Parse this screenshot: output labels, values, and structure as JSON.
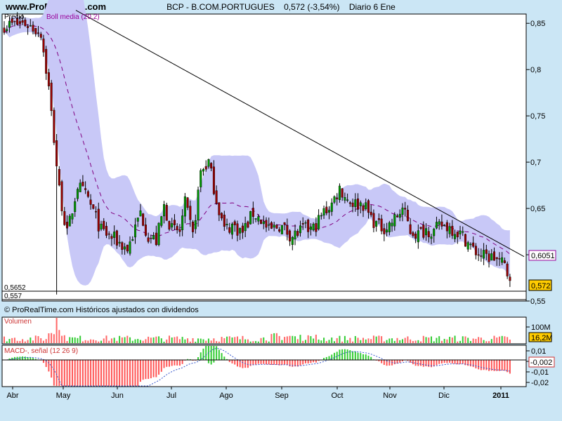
{
  "header": {
    "site": "www.ProRealTime.com",
    "ticker": "BCP - B.COM.PORTUGUES",
    "price": "0,572 (-3,54%)",
    "period": "Diario 6 Ene"
  },
  "colors": {
    "background": "#cbe6f5",
    "panel": "#ffffff",
    "band": "#c8c8f7",
    "bull": "#009900",
    "bear": "#990000",
    "bbmid": "#800080",
    "trend": "#000000",
    "vol_up": "#33cc33",
    "vol_down": "#ff6666",
    "macd_pos": "#33cc33",
    "macd_neg": "#ff5555",
    "signal": "#3355cc"
  },
  "chart_data": {
    "type": "candlestick",
    "price_panel": {
      "labels": [
        "Precio",
        "Boll media (20,2)"
      ],
      "ylim": [
        0.55,
        0.86
      ],
      "yticks": [
        0.55,
        0.6,
        0.65,
        0.7,
        0.75,
        0.8,
        0.85
      ],
      "ytick_labels": [
        "0,55",
        "0,6",
        "0,65",
        "0,7",
        "0,75",
        "0,8",
        "0,85"
      ],
      "last_close_label": "0,572",
      "upper_band_label": "0,6051",
      "min_labels": [
        "0,5652",
        "0,557"
      ],
      "trendline": [
        [
          0,
          0.864
        ],
        [
          1,
          0.598
        ]
      ]
    },
    "footer_note": "© ProRealTime.com Históricos ajustados con dividendos",
    "volume_panel": {
      "label": "Volumen",
      "tick_label": "100M",
      "last_label": "16,2M"
    },
    "macd_panel": {
      "label": "MACD-, señal (12 26 9)",
      "ytick_labels": [
        "0,01",
        "0",
        "-0,01",
        "-0,02"
      ],
      "last_label": "-0,002"
    },
    "x_axis": {
      "labels": [
        "Abr",
        "May",
        "Jun",
        "Jul",
        "Ago",
        "Sep",
        "Oct",
        "Nov",
        "Dic",
        "2011"
      ]
    },
    "anchors": [
      [
        0.83,
        0.848
      ],
      [
        8,
        0.85
      ],
      [
        14,
        0.84
      ],
      [
        17,
        0.78
      ],
      [
        21,
        0.67
      ],
      [
        24,
        0.622
      ],
      [
        28,
        0.675
      ],
      [
        32,
        0.66
      ],
      [
        37,
        0.626
      ],
      [
        43,
        0.615
      ],
      [
        47,
        0.606
      ],
      [
        50,
        0.628
      ],
      [
        52,
        0.646
      ],
      [
        55,
        0.62
      ],
      [
        58,
        0.615
      ],
      [
        61,
        0.652
      ],
      [
        64,
        0.627
      ],
      [
        67,
        0.625
      ],
      [
        69,
        0.655
      ],
      [
        72,
        0.62
      ],
      [
        75,
        0.69
      ],
      [
        78,
        0.7
      ],
      [
        81,
        0.66
      ],
      [
        84,
        0.627
      ],
      [
        87,
        0.632
      ],
      [
        91,
        0.624
      ],
      [
        95,
        0.645
      ],
      [
        98,
        0.638
      ],
      [
        101,
        0.625
      ],
      [
        105,
        0.632
      ],
      [
        110,
        0.62
      ],
      [
        114,
        0.627
      ],
      [
        118,
        0.628
      ],
      [
        122,
        0.646
      ],
      [
        125,
        0.655
      ],
      [
        128,
        0.672
      ],
      [
        131,
        0.66
      ],
      [
        134,
        0.655
      ],
      [
        137,
        0.655
      ],
      [
        140,
        0.64
      ],
      [
        143,
        0.63
      ],
      [
        146,
        0.63
      ],
      [
        149,
        0.638
      ],
      [
        152,
        0.65
      ],
      [
        155,
        0.626
      ],
      [
        158,
        0.622
      ],
      [
        161,
        0.628
      ],
      [
        164,
        0.625
      ],
      [
        167,
        0.632
      ],
      [
        170,
        0.63
      ],
      [
        173,
        0.625
      ],
      [
        176,
        0.617
      ],
      [
        179,
        0.605
      ],
      [
        183,
        0.598
      ],
      [
        187,
        0.597
      ],
      [
        191,
        0.588
      ],
      [
        193,
        0.572
      ]
    ]
  }
}
